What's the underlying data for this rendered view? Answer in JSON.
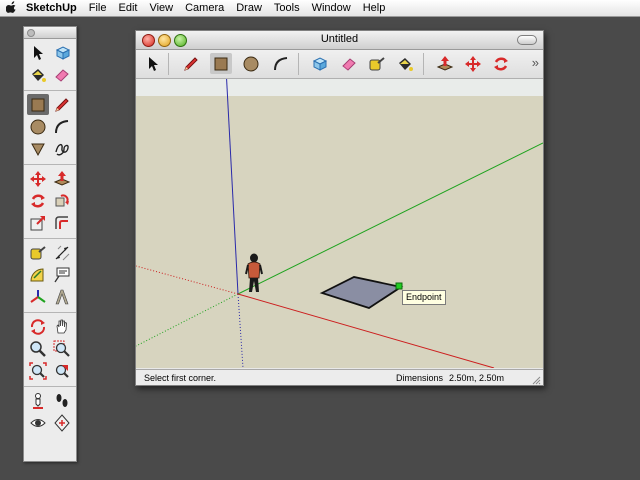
{
  "menubar": {
    "apple_icon": "apple-icon",
    "app_name": "SketchUp",
    "items": [
      "File",
      "Edit",
      "View",
      "Camera",
      "Draw",
      "Tools",
      "Window",
      "Help"
    ]
  },
  "window": {
    "title": "Untitled",
    "toolbar_icons": [
      "select-arrow-icon",
      "pencil-line-icon",
      "rectangle-icon",
      "circle-icon",
      "arc-icon",
      "make-component-icon",
      "eraser-icon",
      "tape-measure-icon",
      "paint-bucket-icon",
      "push-pull-icon",
      "move-icon",
      "rotate-icon"
    ],
    "toolbar_overflow": "»"
  },
  "viewport": {
    "tooltip": "Endpoint",
    "colors": {
      "sky": "#e9ecea",
      "ground": "#d7d4bf",
      "axis_red": "#cc1f1f",
      "axis_green": "#1fa31f",
      "axis_blue": "#2a2aaa",
      "face": "#8a8ea3",
      "endpoint_marker": "#22cc22"
    }
  },
  "status": {
    "text": "Select first corner.",
    "dimensions_label": "Dimensions",
    "dimensions_value": "2.50m, 2.50m"
  },
  "palette": {
    "tools": [
      "select-arrow-icon",
      "make-component-icon",
      "paint-bucket-icon",
      "eraser-icon",
      "rectangle-icon",
      "pencil-line-icon",
      "circle-icon",
      "arc-icon",
      "polygon-icon",
      "freehand-icon",
      "move-icon",
      "push-pull-icon",
      "rotate-icon",
      "follow-me-icon",
      "scale-icon",
      "offset-icon",
      "tape-measure-icon",
      "dimension-icon",
      "protractor-icon",
      "text-icon",
      "axes-icon",
      "3d-text-icon",
      "orbit-icon",
      "pan-icon",
      "zoom-icon",
      "zoom-window-icon",
      "zoom-extents-icon",
      "previous-view-icon",
      "position-camera-icon",
      "walk-icon",
      "look-around-icon",
      "section-plane-icon"
    ]
  }
}
